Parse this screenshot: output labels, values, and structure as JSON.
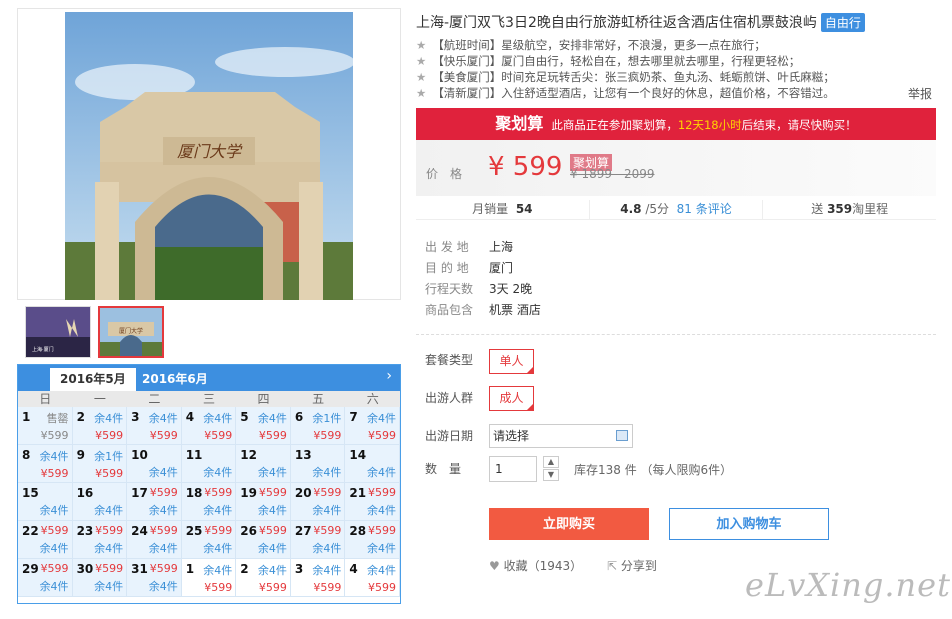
{
  "product": {
    "title": "上海-厦门双飞3日2晚自由行旅游虹桥往返含酒店住宿机票鼓浪屿",
    "badge": "自由行",
    "features": [
      "【航班时间】星级航空，安排非常好，不浪漫，更多一点在旅行；",
      "【快乐厦门】厦门自由行，轻松自在，想去哪里就去哪里，行程更轻松；",
      "【美食厦门】时间充足玩转舌尖：张三疯奶茶、鱼丸汤、蚝蛎煎饼、叶氏麻糍；",
      "【清新厦门】入住舒适型酒店，让您有一个良好的休息，超值价格，不容错过。"
    ],
    "report": "举报",
    "photo_gate_text": "厦门大学",
    "thumb1_caption": "上海·厦门",
    "thumb2_caption": "厦门大学"
  },
  "juhuasuan": {
    "label": "聚划算",
    "msg_pre": "此商品正在参加聚划算，",
    "msg_time": "12天18小时",
    "msg_post": "后结束，请尽快购买！"
  },
  "price": {
    "label": "价格",
    "current": "¥ 599",
    "tag": "聚划算",
    "original": "¥ 1899 - 2099"
  },
  "stats": {
    "sales_label": "月销量",
    "sales": "54",
    "rating": "4.8",
    "rating_unit": "/5分",
    "reviews": "81 条评论",
    "points_label": "送",
    "points": "359",
    "points_unit": "淘里程"
  },
  "info": [
    {
      "k": "出 发 地",
      "v": "上海"
    },
    {
      "k": "目 的 地",
      "v": "厦门"
    },
    {
      "k": "行程天数",
      "v": "3天 2晚"
    },
    {
      "k": "商品包含",
      "v": "机票  酒店"
    }
  ],
  "options": {
    "package_label": "套餐类型",
    "package_value": "单人",
    "group_label": "出游人群",
    "group_value": "成人",
    "date_label": "出游日期",
    "date_placeholder": "请选择",
    "qty_label": "数　量",
    "qty_value": "1",
    "stock": "库存138 件 （每人限购6件）"
  },
  "actions": {
    "buy": "立即购买",
    "cart": "加入购物车",
    "fav": "收藏（1943）",
    "share": "分享到"
  },
  "calendar": {
    "tab_active": "2016年5月",
    "tab_next": "2016年6月",
    "weekdays": [
      "日",
      "一",
      "二",
      "三",
      "四",
      "五",
      "六"
    ],
    "cells": [
      {
        "d": "1",
        "tr": "售罄",
        "trc": "gray",
        "bl": "¥599",
        "blc": "gray"
      },
      {
        "d": "2",
        "tr": "余4件",
        "trc": "blue",
        "bl": "¥599",
        "blc": "red"
      },
      {
        "d": "3",
        "tr": "余4件",
        "trc": "blue",
        "bl": "¥599",
        "blc": "red"
      },
      {
        "d": "4",
        "tr": "余4件",
        "trc": "blue",
        "bl": "¥599",
        "blc": "red"
      },
      {
        "d": "5",
        "tr": "余4件",
        "trc": "blue",
        "bl": "¥599",
        "blc": "red"
      },
      {
        "d": "6",
        "tr": "余1件",
        "trc": "blue",
        "bl": "¥599",
        "blc": "red"
      },
      {
        "d": "7",
        "tr": "余4件",
        "trc": "blue",
        "bl": "¥599",
        "blc": "red"
      },
      {
        "d": "8",
        "tr": "余4件",
        "trc": "blue",
        "bl": "¥599",
        "blc": "red"
      },
      {
        "d": "9",
        "tr": "余1件",
        "trc": "blue",
        "bl": "¥599",
        "blc": "red"
      },
      {
        "d": "10",
        "tr": "",
        "trc": "blue",
        "bl": "余4件",
        "blc": "blue"
      },
      {
        "d": "11",
        "tr": "",
        "trc": "blue",
        "bl": "余4件",
        "blc": "blue"
      },
      {
        "d": "12",
        "tr": "",
        "trc": "blue",
        "bl": "余4件",
        "blc": "blue"
      },
      {
        "d": "13",
        "tr": "",
        "trc": "blue",
        "bl": "余4件",
        "blc": "blue"
      },
      {
        "d": "14",
        "tr": "",
        "trc": "blue",
        "bl": "余4件",
        "blc": "blue"
      },
      {
        "d": "15",
        "tr": "",
        "trc": "blue",
        "bl": "余4件",
        "blc": "blue"
      },
      {
        "d": "16",
        "tr": "",
        "trc": "blue",
        "bl": "余4件",
        "blc": "blue"
      },
      {
        "d": "17",
        "tr": "¥599",
        "trc": "red",
        "bl": "余4件",
        "blc": "blue"
      },
      {
        "d": "18",
        "tr": "¥599",
        "trc": "red",
        "bl": "余4件",
        "blc": "blue"
      },
      {
        "d": "19",
        "tr": "¥599",
        "trc": "red",
        "bl": "余4件",
        "blc": "blue"
      },
      {
        "d": "20",
        "tr": "¥599",
        "trc": "red",
        "bl": "余4件",
        "blc": "blue"
      },
      {
        "d": "21",
        "tr": "¥599",
        "trc": "red",
        "bl": "余4件",
        "blc": "blue"
      },
      {
        "d": "22",
        "tr": "¥599",
        "trc": "red",
        "bl": "余4件",
        "blc": "blue"
      },
      {
        "d": "23",
        "tr": "¥599",
        "trc": "red",
        "bl": "余4件",
        "blc": "blue"
      },
      {
        "d": "24",
        "tr": "¥599",
        "trc": "red",
        "bl": "余4件",
        "blc": "blue"
      },
      {
        "d": "25",
        "tr": "¥599",
        "trc": "red",
        "bl": "余4件",
        "blc": "blue"
      },
      {
        "d": "26",
        "tr": "¥599",
        "trc": "red",
        "bl": "余4件",
        "blc": "blue"
      },
      {
        "d": "27",
        "tr": "¥599",
        "trc": "red",
        "bl": "余4件",
        "blc": "blue"
      },
      {
        "d": "28",
        "tr": "¥599",
        "trc": "red",
        "bl": "余4件",
        "blc": "blue"
      },
      {
        "d": "29",
        "tr": "¥599",
        "trc": "red",
        "bl": "余4件",
        "blc": "blue"
      },
      {
        "d": "30",
        "tr": "¥599",
        "trc": "red",
        "bl": "余4件",
        "blc": "blue"
      },
      {
        "d": "31",
        "tr": "¥599",
        "trc": "red",
        "bl": "余4件",
        "blc": "blue"
      },
      {
        "d": "1",
        "tr": "余4件",
        "trc": "blue",
        "bl": "¥599",
        "blc": "red",
        "other": true
      },
      {
        "d": "2",
        "tr": "余4件",
        "trc": "blue",
        "bl": "¥599",
        "blc": "red",
        "other": true
      },
      {
        "d": "3",
        "tr": "余4件",
        "trc": "blue",
        "bl": "¥599",
        "blc": "red",
        "other": true
      },
      {
        "d": "4",
        "tr": "余4件",
        "trc": "blue",
        "bl": "¥599",
        "blc": "red",
        "other": true
      }
    ]
  },
  "watermark": "eLvXing.net"
}
